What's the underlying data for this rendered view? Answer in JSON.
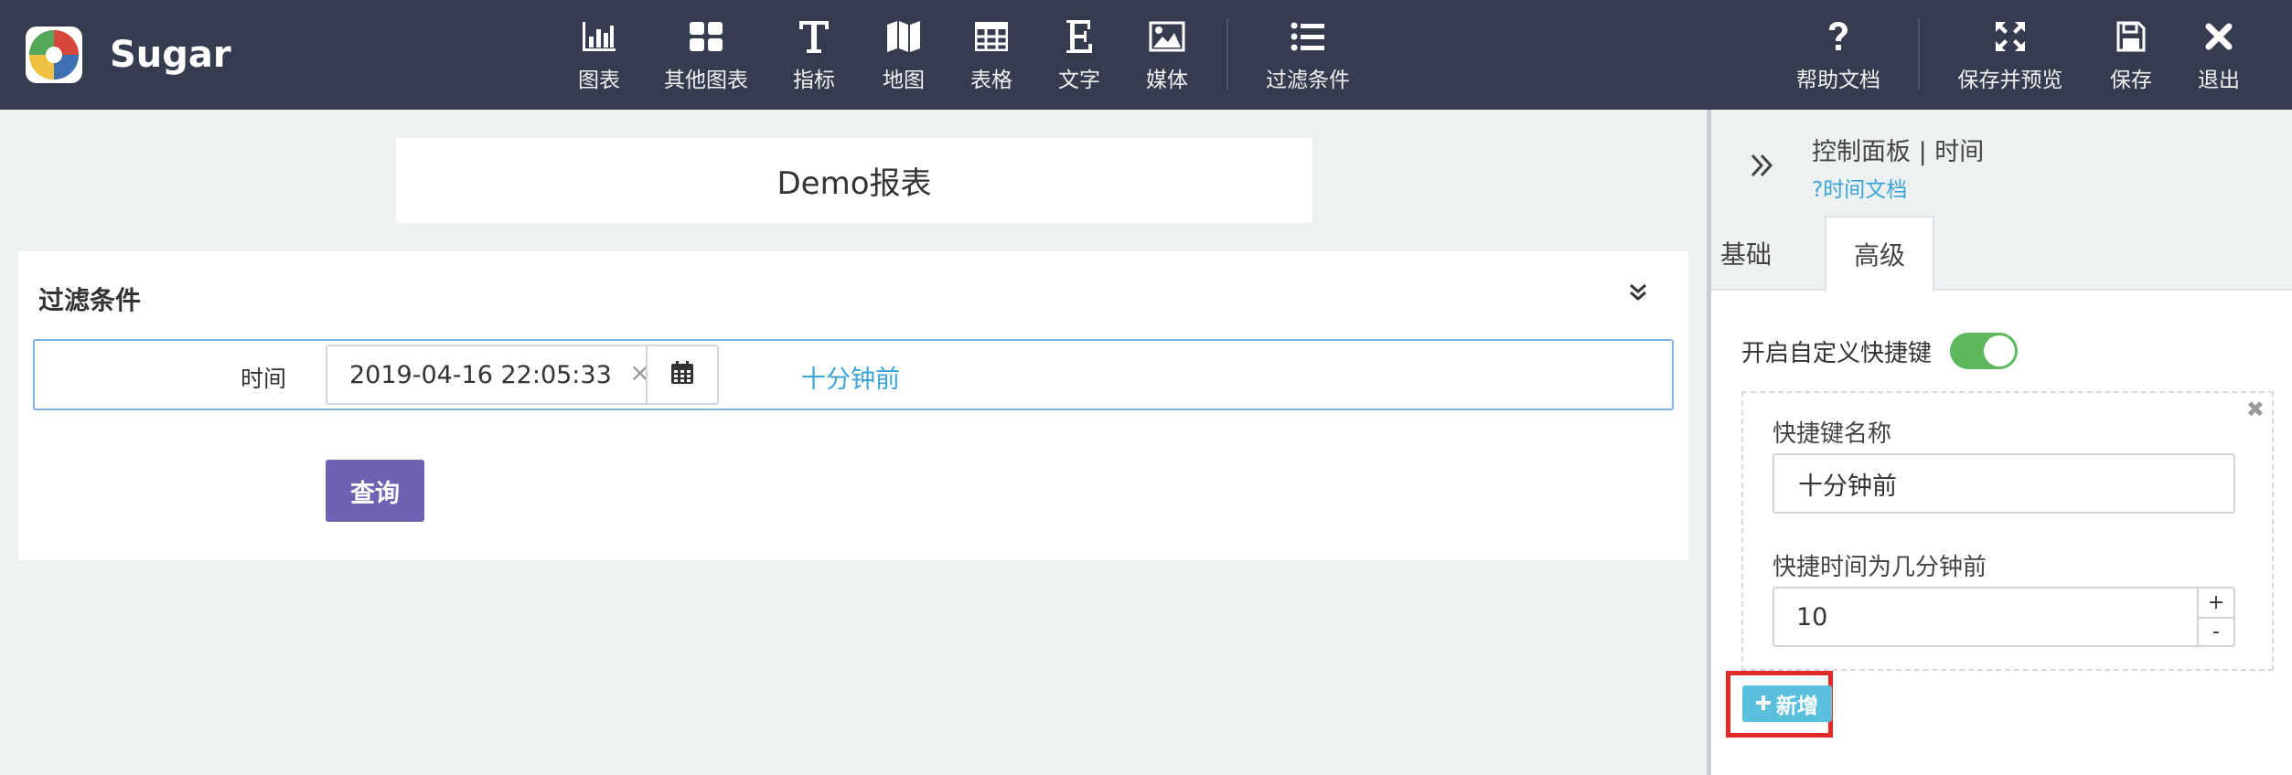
{
  "app": {
    "name": "Sugar"
  },
  "toolbar": {
    "items": [
      {
        "label": "图表",
        "icon": "bar-chart-icon"
      },
      {
        "label": "其他图表",
        "icon": "grid-icon"
      },
      {
        "label": "指标",
        "icon": "text-t-icon"
      },
      {
        "label": "地图",
        "icon": "map-icon"
      },
      {
        "label": "表格",
        "icon": "table-icon"
      },
      {
        "label": "文字",
        "icon": "text-e-icon"
      },
      {
        "label": "媒体",
        "icon": "image-icon"
      },
      {
        "label": "过滤条件",
        "icon": "list-icon"
      }
    ],
    "right_items": [
      {
        "label": "帮助文档",
        "icon": "question-icon"
      },
      {
        "label": "保存并预览",
        "icon": "expand-icon"
      },
      {
        "label": "保存",
        "icon": "floppy-icon"
      },
      {
        "label": "退出",
        "icon": "close-icon"
      }
    ]
  },
  "report": {
    "title": "Demo报表"
  },
  "filter": {
    "title": "过滤条件",
    "time_label": "时间",
    "date_value": "2019-04-16 22:05:33",
    "clear_glyph": "×",
    "shortcut_link": "十分钟前",
    "query_label": "查询"
  },
  "panel": {
    "title": "控制面板 | 时间",
    "doc_link": "?时间文档",
    "tabs": [
      {
        "label": "基础"
      },
      {
        "label": "高级"
      }
    ],
    "active_tab": "高级",
    "custom_shortcut_label": "开启自定义快捷键",
    "custom_shortcut_on": true,
    "shortcut": {
      "name_label": "快捷键名称",
      "name_value": "十分钟前",
      "minutes_label": "快捷时间为几分钟前",
      "minutes_value": "10",
      "inc": "+",
      "dec": "-",
      "close_glyph": "✖"
    },
    "add_label": "新增"
  },
  "colors": {
    "topbar": "#363c50",
    "accent_link": "#3aa4d6",
    "query_button": "#6d63b2",
    "toggle_on": "#5cb85c",
    "add_button": "#5bc0de",
    "highlight": "#e02a2a"
  }
}
